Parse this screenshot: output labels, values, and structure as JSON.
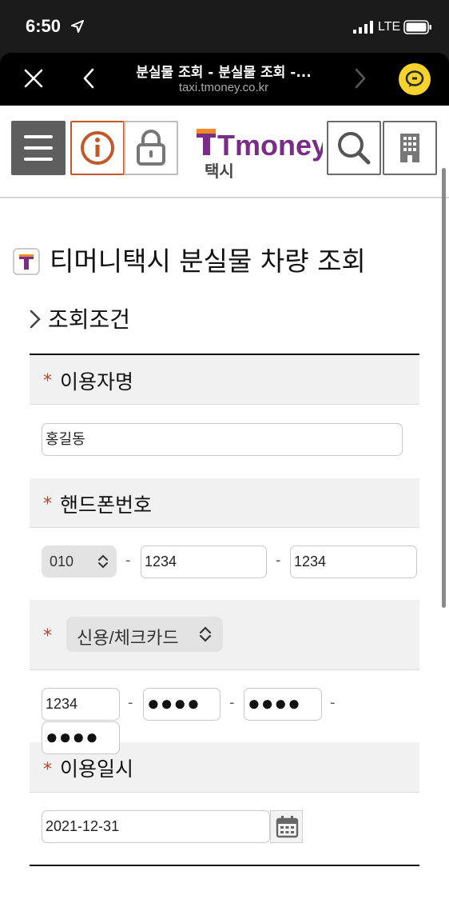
{
  "status_bar": {
    "time": "6:50",
    "network": "LTE"
  },
  "browser": {
    "title": "분실물 조회 - 분실물 조회 -...",
    "url": "taxi.tmoney.co.kr"
  },
  "header": {
    "logo_text": "Tmoney",
    "logo_sub": "택시",
    "icons": [
      "menu-icon",
      "info-icon",
      "lock-icon",
      "search-icon",
      "building-icon"
    ],
    "brand_color": "#7a2d86",
    "accent_color": "#c05a2a"
  },
  "page": {
    "title": "티머니택시 분실물 차량 조회",
    "section_title": "조회조건"
  },
  "form": {
    "required_mark": "*",
    "name": {
      "label": "이용자명",
      "value": "홍길동"
    },
    "phone": {
      "label": "핸드폰번호",
      "prefix_selected": "010",
      "middle": "1234",
      "last": "1234",
      "separator": "-"
    },
    "card": {
      "type_selected": "신용/체크카드",
      "part1": "1234",
      "part2": "●●●●",
      "part3": "●●●●",
      "part4": "●●●●",
      "separator": "-"
    },
    "date": {
      "label": "이용일시",
      "value": "2021-12-31"
    }
  }
}
